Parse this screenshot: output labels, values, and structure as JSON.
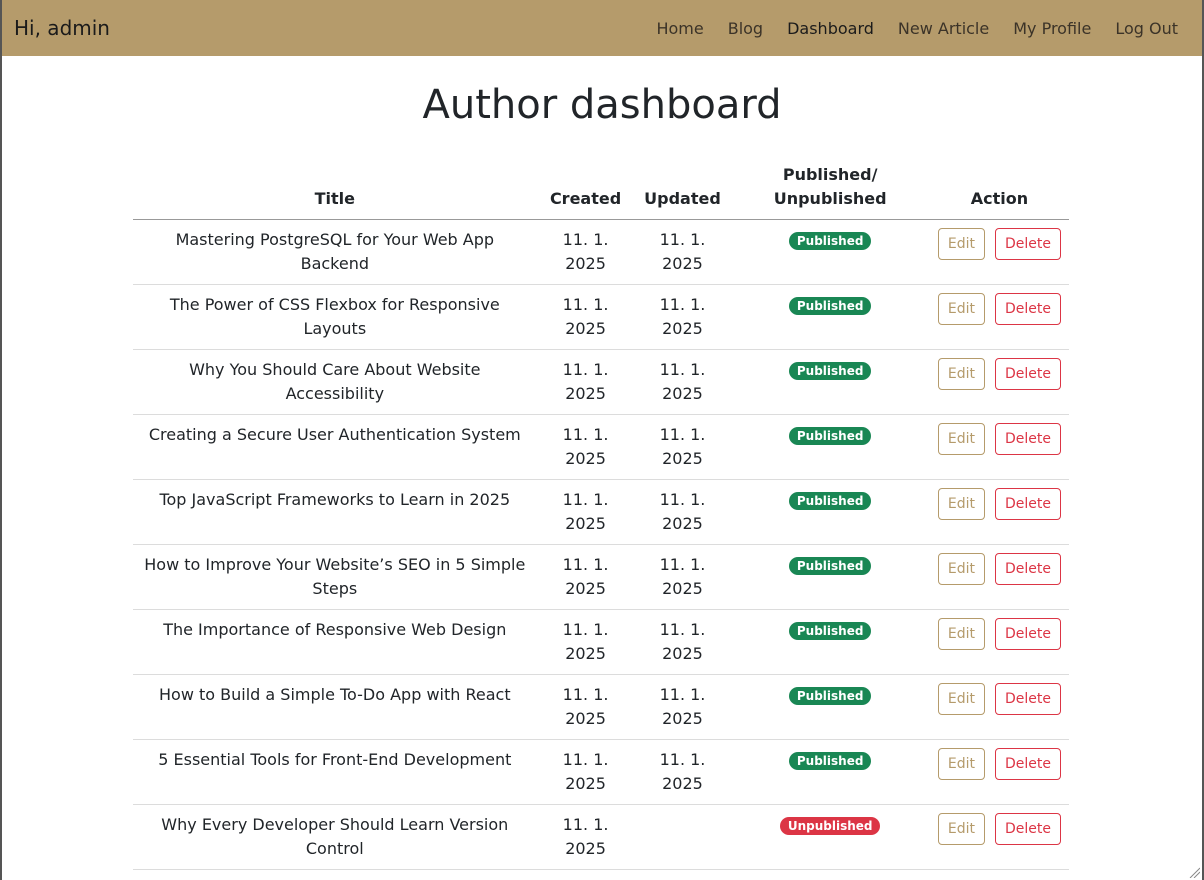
{
  "navbar": {
    "brand": "Hi, admin",
    "links": [
      "Home",
      "Blog",
      "Dashboard",
      "New Article",
      "My Profile",
      "Log Out"
    ],
    "active": "Dashboard"
  },
  "page_title": "Author dashboard",
  "table": {
    "headers": {
      "title": "Title",
      "created": "Created",
      "updated": "Updated",
      "status_line1": "Published/",
      "status_line2": "Unpublished",
      "action": "Action"
    },
    "edit_label": "Edit",
    "delete_label": "Delete",
    "rows": [
      {
        "title": "Mastering PostgreSQL for Your Web App Backend",
        "created": "11. 1. 2025",
        "updated": "11. 1. 2025",
        "status": "Published"
      },
      {
        "title": "The Power of CSS Flexbox for Responsive Layouts",
        "created": "11. 1. 2025",
        "updated": "11. 1. 2025",
        "status": "Published"
      },
      {
        "title": "Why You Should Care About Website Accessibility",
        "created": "11. 1. 2025",
        "updated": "11. 1. 2025",
        "status": "Published"
      },
      {
        "title": "Creating a Secure User Authentication System",
        "created": "11. 1. 2025",
        "updated": "11. 1. 2025",
        "status": "Published"
      },
      {
        "title": "Top JavaScript Frameworks to Learn in 2025",
        "created": "11. 1. 2025",
        "updated": "11. 1. 2025",
        "status": "Published"
      },
      {
        "title": "How to Improve Your Website’s SEO in 5 Simple Steps",
        "created": "11. 1. 2025",
        "updated": "11. 1. 2025",
        "status": "Published"
      },
      {
        "title": "The Importance of Responsive Web Design",
        "created": "11. 1. 2025",
        "updated": "11. 1. 2025",
        "status": "Published"
      },
      {
        "title": "How to Build a Simple To-Do App with React",
        "created": "11. 1. 2025",
        "updated": "11. 1. 2025",
        "status": "Published"
      },
      {
        "title": "5 Essential Tools for Front-End Development",
        "created": "11. 1. 2025",
        "updated": "11. 1. 2025",
        "status": "Published"
      },
      {
        "title": "Why Every Developer Should Learn Version Control",
        "created": "11. 1. 2025",
        "updated": "",
        "status": "Unpublished"
      }
    ]
  },
  "colors": {
    "navbar_bg": "#b59b6b",
    "published": "#198754",
    "unpublished": "#dc3545",
    "edit": "#b59b6b",
    "delete": "#dc3545"
  }
}
